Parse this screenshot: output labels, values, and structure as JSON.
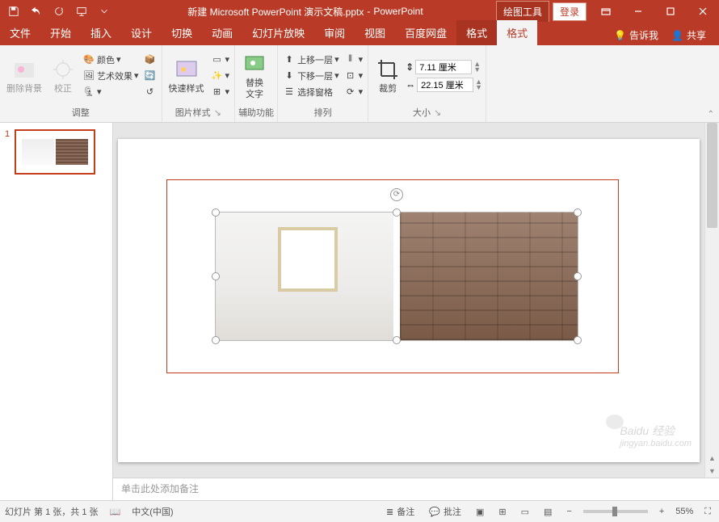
{
  "title": {
    "doc": "新建 Microsoft PowerPoint 演示文稿.pptx",
    "app": "PowerPoint",
    "context_tab": "绘图工具",
    "login": "登录"
  },
  "tabs": {
    "file": "文件",
    "home": "开始",
    "insert": "插入",
    "design": "设计",
    "transitions": "切换",
    "animations": "动画",
    "slideshow": "幻灯片放映",
    "review": "审阅",
    "view": "视图",
    "baidu": "百度网盘",
    "format_ctx": "格式",
    "format_active": "格式",
    "tellme": "告诉我",
    "share": "共享"
  },
  "ribbon": {
    "remove_bg": "删除背景",
    "corrections": "校正",
    "color": "颜色",
    "artistic": "艺术效果",
    "adjust_group": "调整",
    "quick_styles": "快速样式",
    "pic_styles_group": "图片样式",
    "alt_text": "替换\n文字",
    "access_group": "辅助功能",
    "bring_forward": "上移一层",
    "send_backward": "下移一层",
    "selection_pane": "选择窗格",
    "arrange_group": "排列",
    "crop": "裁剪",
    "size_group": "大小",
    "height_value": "7.11 厘米",
    "width_value": "22.15 厘米"
  },
  "thumbnails": {
    "slide1_num": "1"
  },
  "notes_placeholder": "单击此处添加备注",
  "statusbar": {
    "slide_info": "幻灯片 第 1 张，共 1 张",
    "language": "中文(中国)",
    "notes_btn": "备注",
    "comments_btn": "批注",
    "zoom_pct": "55%"
  },
  "watermark": {
    "brand": "Baidu 经验",
    "url": "jingyan.baidu.com"
  }
}
